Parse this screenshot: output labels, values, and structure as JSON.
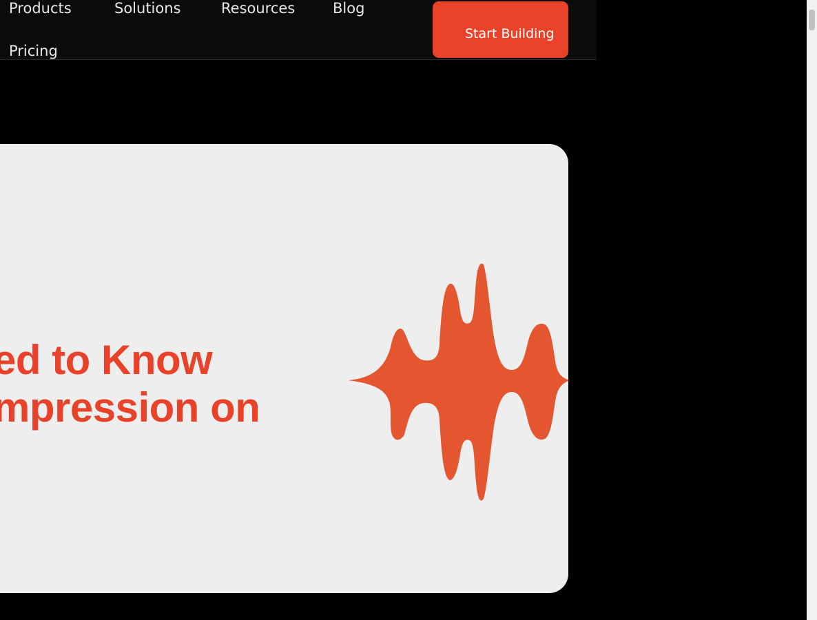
{
  "nav": {
    "items": [
      {
        "label": "Products"
      },
      {
        "label": "Solutions"
      },
      {
        "label": "Resources"
      },
      {
        "label": "Blog"
      },
      {
        "label": "Pricing"
      }
    ],
    "cta_label": "Start Building"
  },
  "hero": {
    "line1": "ed to Know",
    "line2": "mpression on",
    "icon": "sound-wave-icon"
  },
  "colors": {
    "accent": "#e8432a",
    "wave": "#e35630",
    "card_bg": "#eeeeee",
    "page_bg": "#000000"
  }
}
